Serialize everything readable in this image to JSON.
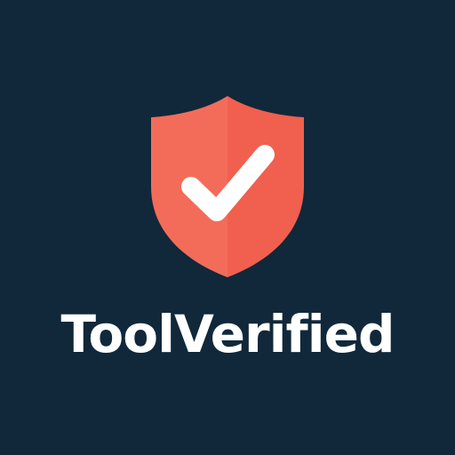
{
  "brand": {
    "name": "ToolVerified",
    "background_color": "#10283a",
    "text_color": "#ffffff",
    "icon": "shield-check-icon",
    "icon_colors": {
      "left_half": "#f36c5a",
      "right_half": "#f15f4f",
      "check": "#ffffff"
    }
  }
}
